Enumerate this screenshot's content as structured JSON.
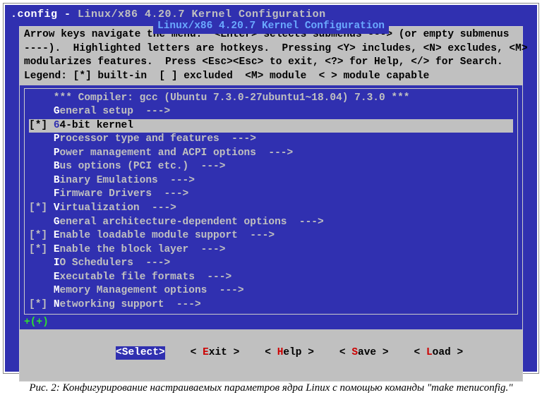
{
  "title_bar": {
    "prefix": ".config - ",
    "kernel": "Linux/x86 4.20.7 Kernel Configuration"
  },
  "outer_box_title": " Linux/x86 4.20.7 Kernel Configuration ",
  "help": {
    "l1": "Arrow keys navigate the menu.  <Enter> selects submenus ---> (or empty submenus",
    "l2": "----).  Highlighted letters are hotkeys.  Pressing <Y> includes, <N> excludes, <M>",
    "l3": "modularizes features.  Press <Esc><Esc> to exit, <?> for Help, </> for Search.",
    "l4": "Legend: [*] built-in  [ ] excluded  <M> module  < > module capable"
  },
  "compiler_line": "    *** Compiler: gcc (Ubuntu 7.3.0-27ubuntu1~18.04) 7.3.0 ***",
  "menu": [
    {
      "prefix": "    ",
      "hot": "G",
      "rest": "eneral setup  --->",
      "selected": false
    },
    {
      "prefix": "[*] ",
      "hot": "6",
      "rest": "4-bit kernel",
      "selected": true
    },
    {
      "prefix": "    ",
      "hot": "P",
      "rest": "rocessor type and features  --->",
      "selected": false
    },
    {
      "prefix": "    ",
      "hot": "P",
      "rest": "ower management and ACPI options  --->",
      "selected": false
    },
    {
      "prefix": "    ",
      "hot": "B",
      "rest": "us options (PCI etc.)  --->",
      "selected": false
    },
    {
      "prefix": "    ",
      "hot": "B",
      "rest": "inary Emulations  --->",
      "selected": false
    },
    {
      "prefix": "    ",
      "hot": "F",
      "rest": "irmware Drivers  --->",
      "selected": false
    },
    {
      "prefix": "[*] ",
      "hot": "V",
      "rest": "irtualization  --->",
      "selected": false
    },
    {
      "prefix": "    ",
      "hot": "G",
      "rest": "eneral architecture-dependent options  --->",
      "selected": false
    },
    {
      "prefix": "[*] ",
      "hot": "E",
      "rest": "nable loadable module support  --->",
      "selected": false
    },
    {
      "prefix": "[*] ",
      "hot": "E",
      "rest": "nable the block layer  --->",
      "selected": false
    },
    {
      "prefix": "    ",
      "hot": "I",
      "rest": "O Schedulers  --->",
      "selected": false
    },
    {
      "prefix": "    ",
      "hot": "E",
      "rest": "xecutable file formats  --->",
      "selected": false
    },
    {
      "prefix": "    ",
      "hot": "M",
      "rest": "emory Management options  --->",
      "selected": false
    },
    {
      "prefix": "[*] ",
      "hot": "N",
      "rest": "etworking support  --->",
      "selected": false
    }
  ],
  "scroll_indicator": "+(+)",
  "buttons": [
    {
      "pre": "<",
      "hot": "S",
      "post": "elect>",
      "active": true
    },
    {
      "pre": "< ",
      "hot": "E",
      "post": "xit >",
      "active": false
    },
    {
      "pre": "< ",
      "hot": "H",
      "post": "elp >",
      "active": false
    },
    {
      "pre": "< ",
      "hot": "S",
      "post": "ave >",
      "active": false
    },
    {
      "pre": "< ",
      "hot": "L",
      "post": "oad >",
      "active": false
    }
  ],
  "caption": "Рис. 2: Конфигурирование настраиваемых параметров ядра Linux с помощью команды \"make menuconfig.\""
}
